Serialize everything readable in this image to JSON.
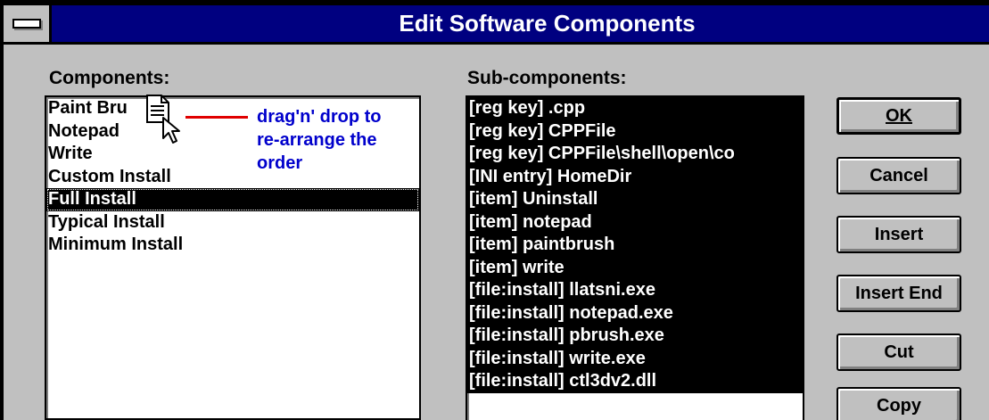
{
  "window": {
    "title": "Edit Software Components"
  },
  "components": {
    "label": "Components:",
    "items": [
      "Paint Bru",
      "Notepad",
      "Write",
      "Custom Install",
      "Full Install",
      "Typical Install",
      "Minimum Install"
    ],
    "selected": "Full Install"
  },
  "subcomponents": {
    "label": "Sub-components:",
    "items": [
      "[reg key] .cpp",
      "[reg key] CPPFile",
      "[reg key] CPPFile\\shell\\open\\co",
      "[INI entry] HomeDir",
      "[item] Uninstall",
      "[item] notepad",
      "[item] paintbrush",
      "[item] write",
      "[file:install] llatsni.exe",
      "[file:install] notepad.exe",
      "[file:install] pbrush.exe",
      "[file:install] write.exe",
      "[file:install] ctl3dv2.dll"
    ]
  },
  "buttons": {
    "ok": "OK",
    "cancel": "Cancel",
    "insert": "Insert",
    "insert_end": "Insert End",
    "cut": "Cut",
    "copy": "Copy"
  },
  "annotation": {
    "line1": "drag'n' drop to",
    "line2": "re-arrange the",
    "line3": "order",
    "color": "#0000cc",
    "arrow_color": "#e00000"
  },
  "icons": {
    "system_menu": "system-menu-icon",
    "drag_document": "document-drag-icon",
    "pointer": "arrow-cursor-icon"
  }
}
